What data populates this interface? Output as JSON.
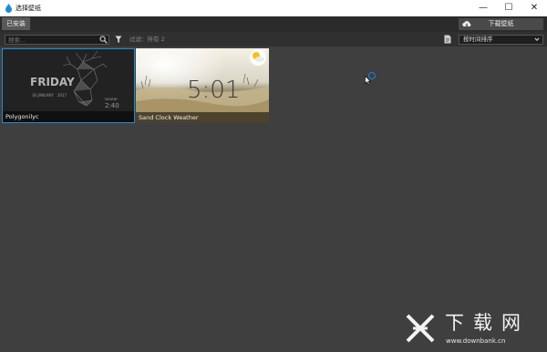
{
  "window": {
    "title": "选择壁纸",
    "controls": {
      "minimize": "—",
      "maximize": "☐",
      "close": "✕"
    }
  },
  "tabs": {
    "installed_label": "已安装"
  },
  "actions": {
    "download_label": "下载壁纸"
  },
  "toolbar": {
    "search_placeholder": "搜索...",
    "filter_text": "过滤：所有 2",
    "sort_value": "按时间排序"
  },
  "wallpapers": [
    {
      "name": "Polygonilyc",
      "selected": true,
      "preview_text": [
        "FRIDAY",
        "30 JANUARY",
        "2017",
        "NEARBY",
        "2:40"
      ]
    },
    {
      "name": "Sand Clock Weather",
      "selected": false,
      "preview_text": "5:01"
    }
  ],
  "watermark": {
    "name": "下载网",
    "url": "www.downbank.cn"
  },
  "icons": [
    "app-drop-icon",
    "cloud-download-icon",
    "search-icon",
    "filter-icon",
    "document-icon",
    "chevron-down-icon",
    "cursor-arrow-icon",
    "busy-spinner-icon",
    "sun-cloud-icon",
    "downbank-logo-icon"
  ],
  "colors": {
    "accent": "#1a8fd6",
    "background": "#3f3f3f",
    "toolbar": "#303030",
    "tabbar": "#2b2b2b"
  }
}
